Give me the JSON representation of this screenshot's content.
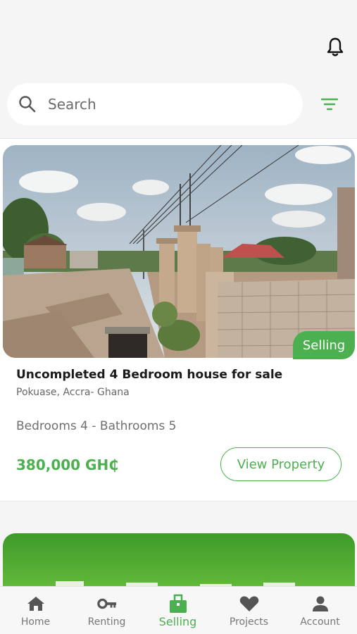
{
  "header": {
    "notification_icon": "bell-icon"
  },
  "search": {
    "placeholder": "Search",
    "search_icon": "search-icon",
    "filter_icon": "filter-icon"
  },
  "listing": {
    "badge": "Selling",
    "title": "Uncompleted 4 Bedroom house for sale",
    "location": "Pokuase, Accra- Ghana",
    "rooms": "Bedrooms 4 - Bathrooms 5",
    "price": "380,000 GH₵",
    "view_button": "View Property"
  },
  "bottom_nav": {
    "items": [
      {
        "label": "Home",
        "icon": "home-icon"
      },
      {
        "label": "Renting",
        "icon": "key-icon"
      },
      {
        "label": "Selling",
        "icon": "shopping-bag-icon",
        "active": true
      },
      {
        "label": "Projects",
        "icon": "heart-icon"
      },
      {
        "label": "Account",
        "icon": "person-icon"
      }
    ]
  },
  "colors": {
    "accent": "#4caf50",
    "background": "#f5f5f5",
    "text_primary": "#1a1a1a",
    "text_secondary": "#666666"
  }
}
